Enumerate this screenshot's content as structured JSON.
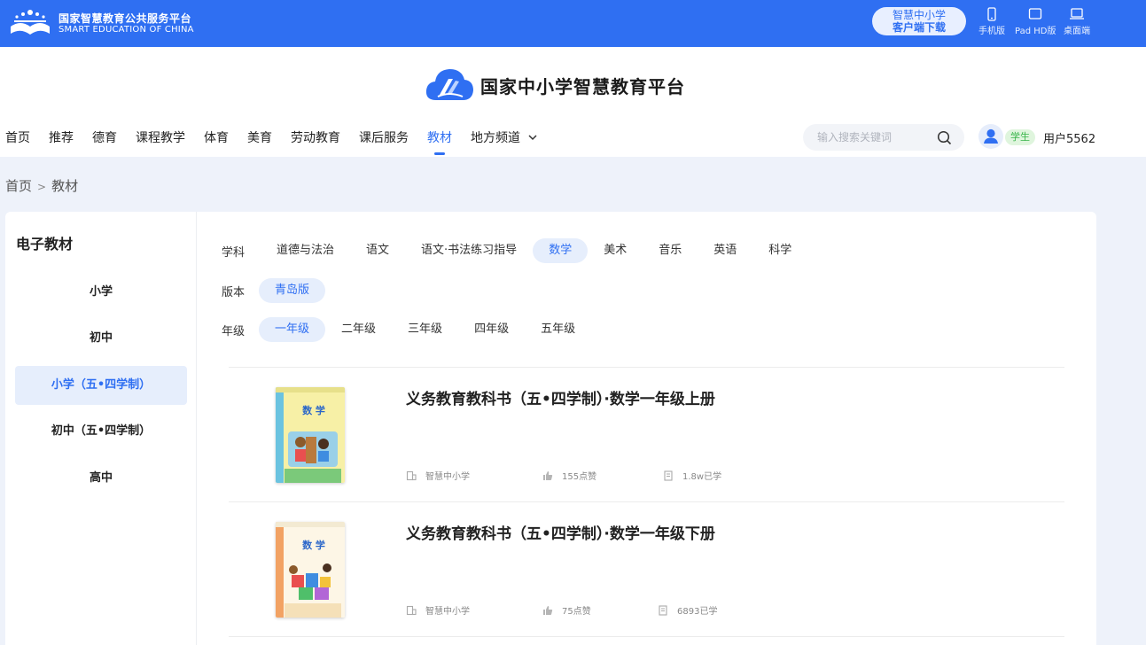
{
  "topbar": {
    "logo_cn": "国家智慧教育公共服务平台",
    "logo_en": "SMART EDUCATION OF CHINA",
    "client_line1": "智慧中小学",
    "client_line2": "客户端下载",
    "devices": [
      "手机版",
      "Pad HD版",
      "桌面端"
    ],
    "bg_color": "#2f6ff2"
  },
  "brand": {
    "title": "国家中小学智慧教育平台"
  },
  "nav": {
    "items": [
      "首页",
      "推荐",
      "德育",
      "课程教学",
      "体育",
      "美育",
      "劳动教育",
      "课后服务",
      "教材",
      "地方频道"
    ],
    "active": "教材"
  },
  "search": {
    "placeholder": "输入搜索关键词"
  },
  "user": {
    "role": "学生",
    "name": "用户5562"
  },
  "breadcrumb": {
    "home": "首页",
    "sep": ">",
    "current": "教材"
  },
  "sidebar": {
    "title": "电子教材",
    "items": [
      "小学",
      "初中",
      "小学（五•四学制）",
      "初中（五•四学制）",
      "高中"
    ],
    "active": "小学（五•四学制）"
  },
  "filters": {
    "subject_label": "学科",
    "subjects": [
      "道德与法治",
      "语文",
      "语文·书法练习指导",
      "数学",
      "美术",
      "音乐",
      "英语",
      "科学"
    ],
    "subject_active": "数学",
    "edition_label": "版本",
    "editions": [
      "青岛版"
    ],
    "edition_active": "青岛版",
    "grade_label": "年级",
    "grades": [
      "一年级",
      "二年级",
      "三年级",
      "四年级",
      "五年级"
    ],
    "grade_active": "一年级"
  },
  "books": [
    {
      "title": "义务教育教科书（五•四学制）·数学一年级上册",
      "source": "智慧中小学",
      "likes": "155点赞",
      "learners": "1.8w已学",
      "cover_text": "数 学"
    },
    {
      "title": "义务教育教科书（五•四学制）·数学一年级下册",
      "source": "智慧中小学",
      "likes": "75点赞",
      "learners": "6893已学",
      "cover_text": "数 学"
    }
  ]
}
